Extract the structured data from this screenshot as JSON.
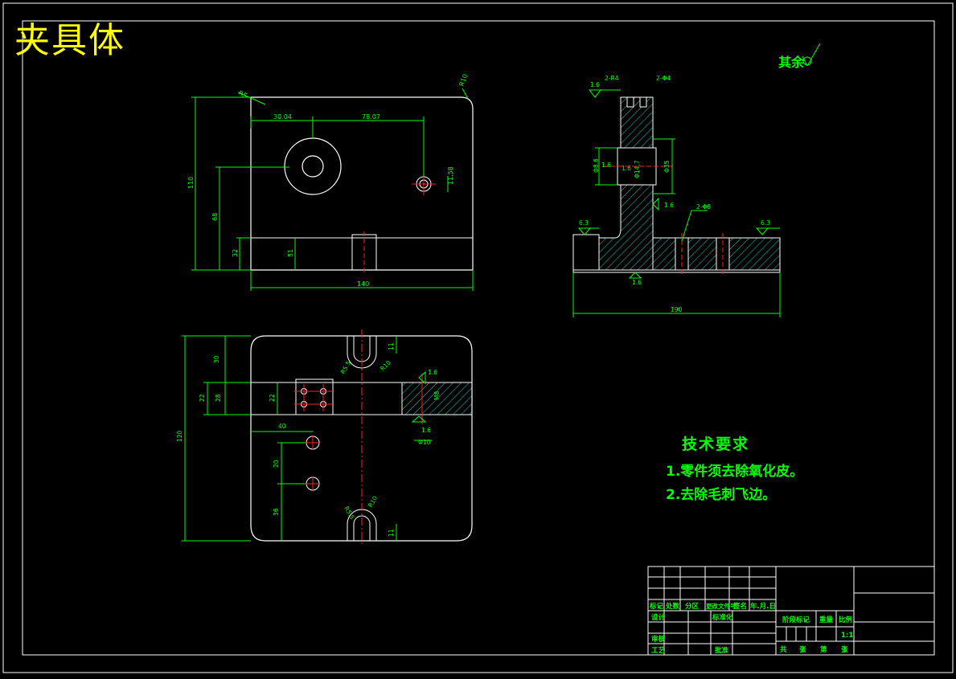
{
  "drawing": {
    "title": "夹具体",
    "surface_note": "其余",
    "tech_requirements": {
      "heading": "技术要求",
      "items": [
        "1.零件须去除氧化皮。",
        "2.去除毛刺飞边。"
      ]
    }
  },
  "front_view": {
    "dims": {
      "d1": "30.04",
      "d2": "78.07",
      "d3": "140",
      "d4": "110",
      "d5": "68",
      "d6": "32",
      "d7": "51",
      "d8": "11.58",
      "r1": "R5",
      "r2": "R10"
    }
  },
  "side_view": {
    "dims": {
      "top_left": "1.6",
      "top_slot1": "2-R4",
      "top_slot2": "2-Φ4",
      "mid1": "1.6",
      "mid2": "1.6",
      "mid3": "Φ8.6",
      "mid4": "Φ14.7",
      "mid5": "Φ35",
      "mid6": "1.6",
      "holes": "2-Φ8",
      "left_ra": "6.3",
      "right_ra": "6.3",
      "bottom_ra": "1.6",
      "width": "190"
    }
  },
  "plan_view": {
    "dims": {
      "h1": "30",
      "h2": "22",
      "h3": "28",
      "h4": "22",
      "h5": "40",
      "h6": "120",
      "h7": "20",
      "h8": "36",
      "r1": "R10",
      "r2": "R5.5",
      "r3": "R10",
      "r4": "R5.5",
      "t1": "11",
      "t2": "11",
      "ra1": "1.6",
      "ra2": "1.6",
      "dia": "Φ10",
      "m": "M8"
    }
  },
  "title_block": {
    "r1": [
      "标记",
      "处数",
      "分区",
      "更改文件号",
      "签名",
      "年.月.日"
    ],
    "r2": [
      "设计",
      "标准化"
    ],
    "r3": [
      "审核"
    ],
    "r4": [
      "工艺",
      "批准"
    ],
    "mid": [
      "阶段标记",
      "重量",
      "比例"
    ],
    "scale": "1:1",
    "sheet": [
      "共",
      "张",
      "第",
      "张"
    ]
  }
}
